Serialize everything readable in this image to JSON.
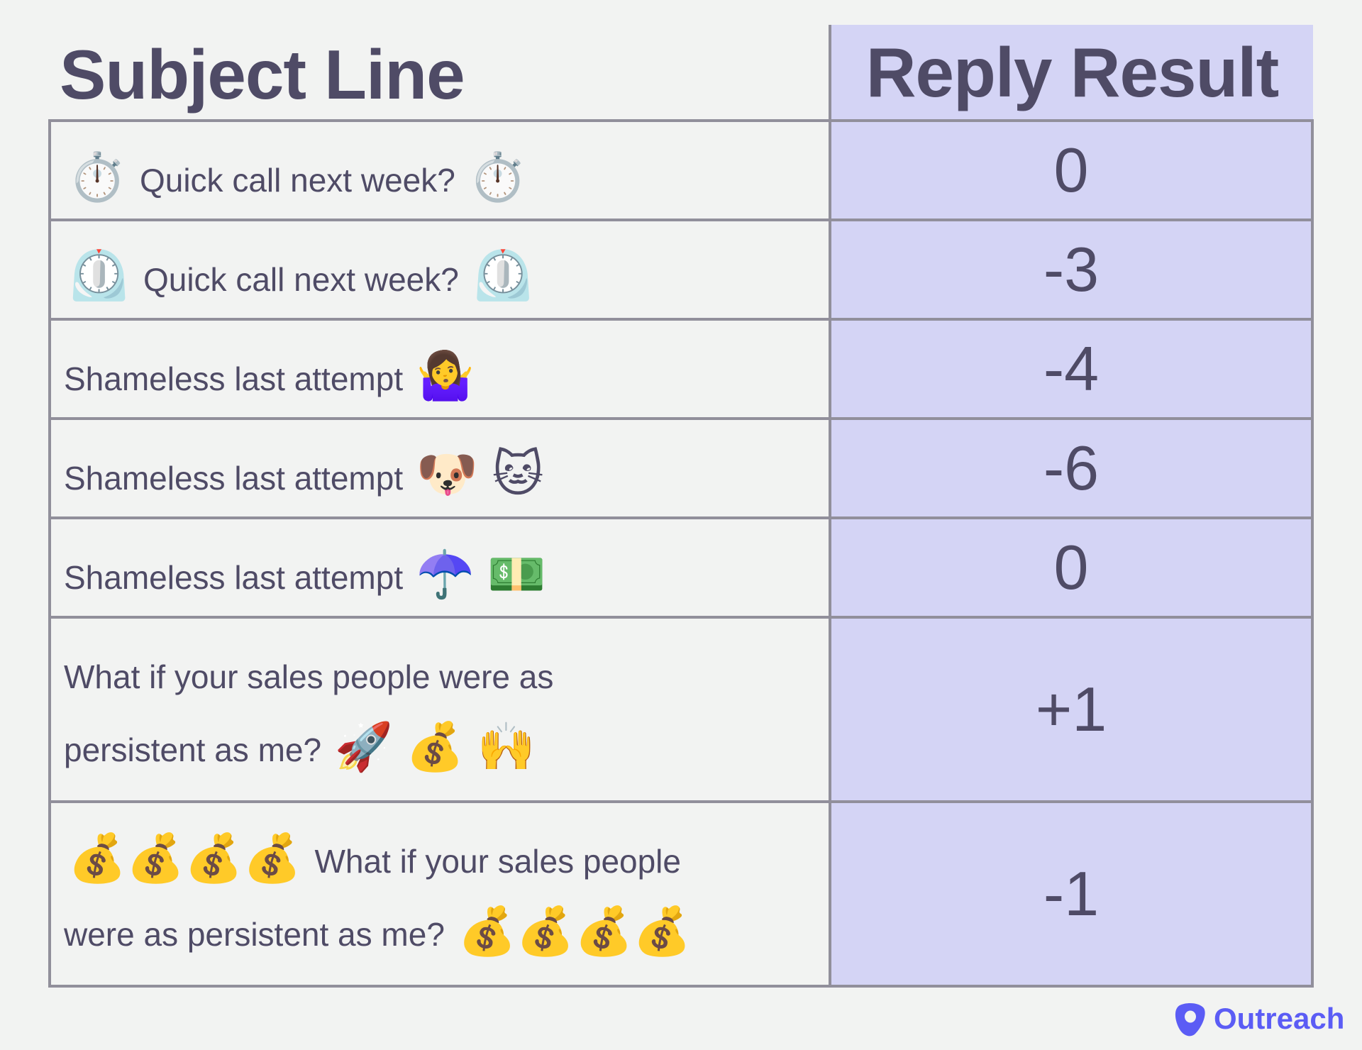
{
  "header": {
    "subject_line": "Subject Line",
    "reply_result": "Reply Result"
  },
  "rows": [
    {
      "before": "⏱️",
      "text": "Quick call next week?",
      "after": "⏱️",
      "result": "0"
    },
    {
      "before": "⏲️",
      "text": "Quick call next week?",
      "after": "⏲️",
      "result": "-3"
    },
    {
      "before": "",
      "text": "Shameless last attempt",
      "after": "🤷‍♀️",
      "result": "-4"
    },
    {
      "before": "",
      "text": "Shameless last attempt",
      "after": "🐶 🐱",
      "result": "-6"
    },
    {
      "before": "",
      "text": "Shameless last attempt",
      "after": "☂️ 💵",
      "result": "0"
    },
    {
      "before": "",
      "text_line1": "What if your sales people were as",
      "text_line2": "persistent as me?",
      "after": "🚀 💰 🙌",
      "result": "+1"
    },
    {
      "before": "💰💰💰💰",
      "text_line1": "What if your sales people",
      "text_line2": "were as persistent as me?",
      "after": "💰💰💰💰",
      "result": "-1"
    }
  ],
  "logo": {
    "text": "Outreach",
    "icon": "outreach-logo-icon",
    "color": "#5b5cf5"
  },
  "colors": {
    "text": "#4f4b66",
    "result_column_bg": "#d4d4f5",
    "border": "#918f9b",
    "background": "#f2f3f2"
  }
}
